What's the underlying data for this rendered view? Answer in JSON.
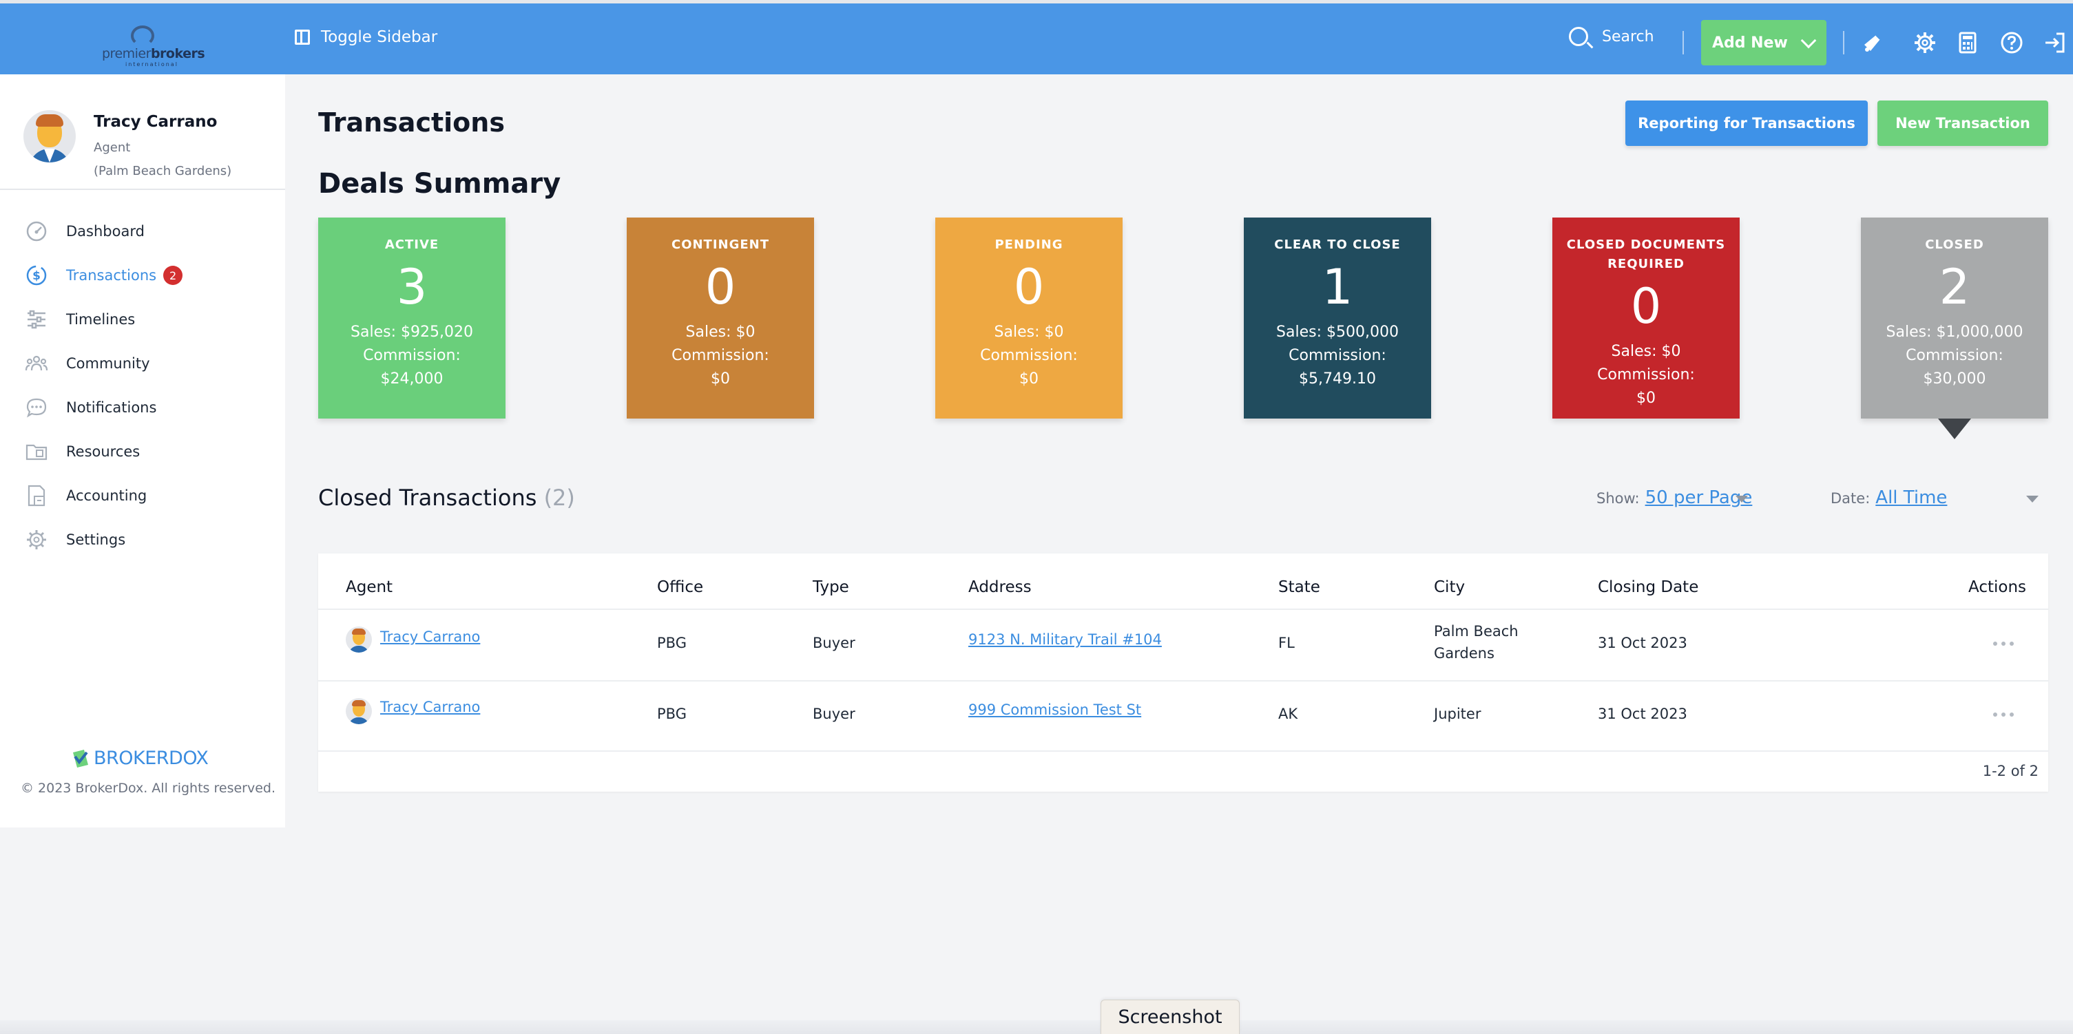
{
  "brand": {
    "logo_word_light": "premier",
    "logo_word_bold": "brokers",
    "logo_sub": "international"
  },
  "topbar": {
    "toggle_label": "Toggle Sidebar",
    "search_label": "Search",
    "add_new_label": "Add New",
    "accent": "#4a96e6"
  },
  "profile": {
    "name": "Tracy Carrano",
    "role": "Agent",
    "office": "(Palm Beach Gardens)"
  },
  "sidebar": {
    "items": [
      {
        "label": "Dashboard",
        "icon": "gauge-icon"
      },
      {
        "label": "Transactions",
        "icon": "dollar-circle-icon",
        "badge": "2",
        "active": true
      },
      {
        "label": "Timelines",
        "icon": "sliders-icon"
      },
      {
        "label": "Community",
        "icon": "people-icon"
      },
      {
        "label": "Notifications",
        "icon": "chat-bubble-icon"
      },
      {
        "label": "Resources",
        "icon": "folder-icon"
      },
      {
        "label": "Accounting",
        "icon": "ledger-icon"
      },
      {
        "label": "Settings",
        "icon": "gear-icon"
      }
    ],
    "footer_logo": "BROKERDOX",
    "copyright": "© 2023 BrokerDox. All rights reserved."
  },
  "main": {
    "page_title": "Transactions",
    "reporting_button": "Reporting for Transactions",
    "new_transaction_button": "New Transaction",
    "deals_summary_title": "Deals Summary",
    "cards": [
      {
        "label": "ACTIVE",
        "count": "3",
        "sales": "Sales: $925,020",
        "commission_label": "Commission:",
        "commission": "$24,000",
        "color": "#6acf7b"
      },
      {
        "label": "CONTINGENT",
        "count": "0",
        "sales": "Sales: $0",
        "commission_label": "Commission:",
        "commission": "$0",
        "color": "#c88338"
      },
      {
        "label": "PENDING",
        "count": "0",
        "sales": "Sales: $0",
        "commission_label": "Commission:",
        "commission": "$0",
        "color": "#eea842"
      },
      {
        "label": "CLEAR TO CLOSE",
        "count": "1",
        "sales": "Sales: $500,000",
        "commission_label": "Commission:",
        "commission": "$5,749.10",
        "color": "#214c5e"
      },
      {
        "label": "CLOSED DOCUMENTS REQUIRED",
        "count": "0",
        "sales": "Sales: $0",
        "commission_label": "Commission:",
        "commission": "$0",
        "color": "#c4262b"
      },
      {
        "label": "CLOSED",
        "count": "2",
        "sales": "Sales: $1,000,000",
        "commission_label": "Commission:",
        "commission": "$30,000",
        "color": "#a8aaab",
        "selected": true
      }
    ],
    "closed": {
      "title": "Closed Transactions",
      "count": "(2)",
      "show_label": "Show:",
      "show_value": "50 per Page",
      "date_label": "Date:",
      "date_value": "All Time"
    },
    "table": {
      "columns": [
        "Agent",
        "Office",
        "Type",
        "Address",
        "State",
        "City",
        "Closing Date",
        "Actions"
      ],
      "rows": [
        {
          "agent": "Tracy Carrano",
          "office": "PBG",
          "type": "Buyer",
          "address": "9123 N. Military Trail #104",
          "state": "FL",
          "city_line1": "Palm Beach",
          "city_line2": "Gardens",
          "closing_date": "31 Oct 2023"
        },
        {
          "agent": "Tracy Carrano",
          "office": "PBG",
          "type": "Buyer",
          "address": "999 Commission Test St",
          "state": "AK",
          "city_line1": "Jupiter",
          "city_line2": "",
          "closing_date": "31 Oct 2023"
        }
      ],
      "pager": "1-2 of 2"
    }
  },
  "screenshot_tag": "Screenshot"
}
